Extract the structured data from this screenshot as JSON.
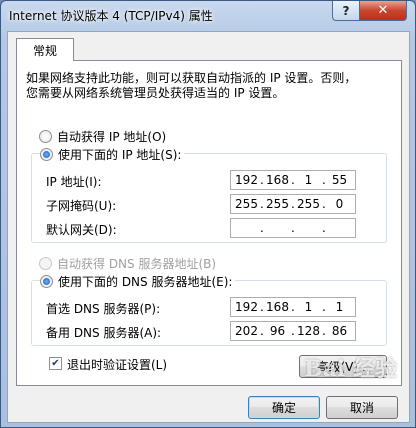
{
  "window": {
    "title": "Internet 协议版本 4 (TCP/IPv4) 属性",
    "help_glyph": "?",
    "close_glyph": "✕"
  },
  "tabs": [
    {
      "label": "常规"
    }
  ],
  "description": {
    "line1": "如果网络支持此功能，则可以获取自动指派的 IP 设置。否则，",
    "line2": "您需要从网络系统管理员处获得适当的 IP 设置。"
  },
  "ip_section": {
    "auto_label": "自动获得 IP 地址(O)",
    "manual_label": "使用下面的 IP 地址(S):",
    "fields": [
      {
        "label": "IP 地址(I):",
        "octets": [
          "192",
          "168",
          "1",
          "55"
        ]
      },
      {
        "label": "子网掩码(U):",
        "octets": [
          "255",
          "255",
          "255",
          "0"
        ]
      },
      {
        "label": "默认网关(D):",
        "octets": [
          "",
          "",
          "",
          ""
        ]
      }
    ]
  },
  "dns_section": {
    "auto_label": "自动获得 DNS 服务器地址(B)",
    "manual_label": "使用下面的 DNS 服务器地址(E):",
    "fields": [
      {
        "label": "首选 DNS 服务器(P):",
        "octets": [
          "192",
          "168",
          "1",
          "1"
        ]
      },
      {
        "label": "备用 DNS 服务器(A):",
        "octets": [
          "202",
          "96",
          "128",
          "86"
        ]
      }
    ]
  },
  "validate_checkbox": {
    "label": "退出时验证设置(L)",
    "checked": true,
    "glyph": "✔"
  },
  "buttons": {
    "advanced": "高级(V)...",
    "ok": "确定",
    "cancel": "取消"
  },
  "watermark": "Bai 经验"
}
